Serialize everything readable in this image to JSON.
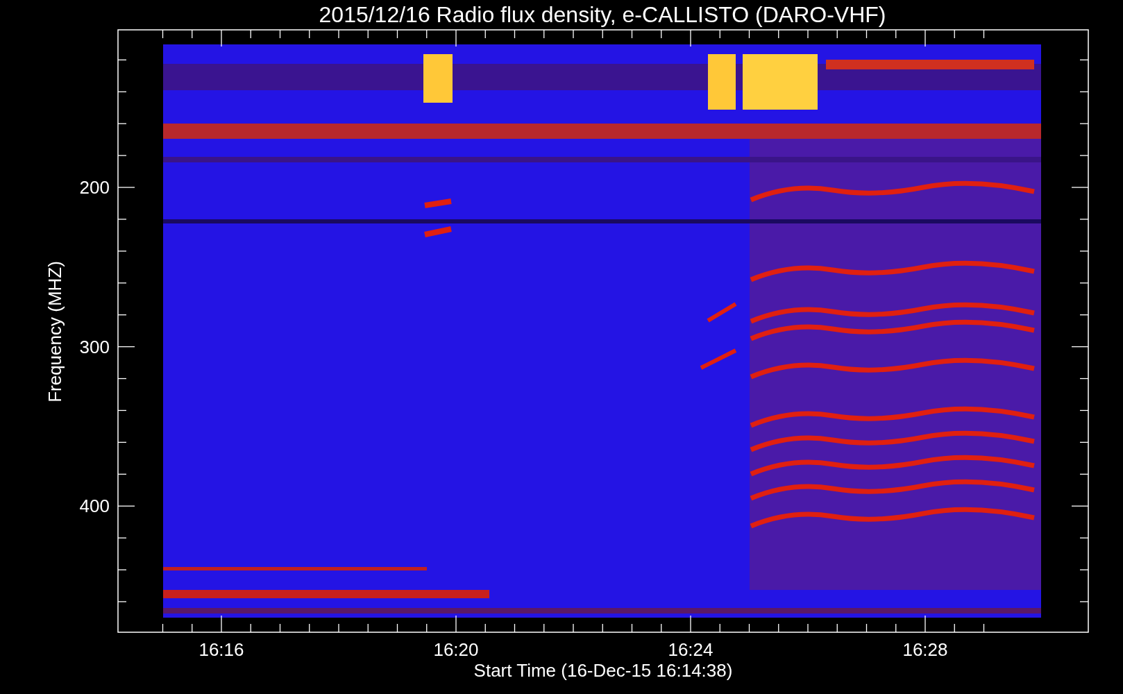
{
  "title": "2015/12/16  Radio flux density, e-CALLISTO (DARO-VHF)",
  "y_axis": {
    "label": "Frequency (MHZ)",
    "ticks": [
      "200",
      "300",
      "400"
    ]
  },
  "x_axis": {
    "label": "Start Time (16-Dec-15 16:14:38)",
    "ticks": [
      "16:16",
      "16:20",
      "16:24",
      "16:28"
    ]
  }
}
